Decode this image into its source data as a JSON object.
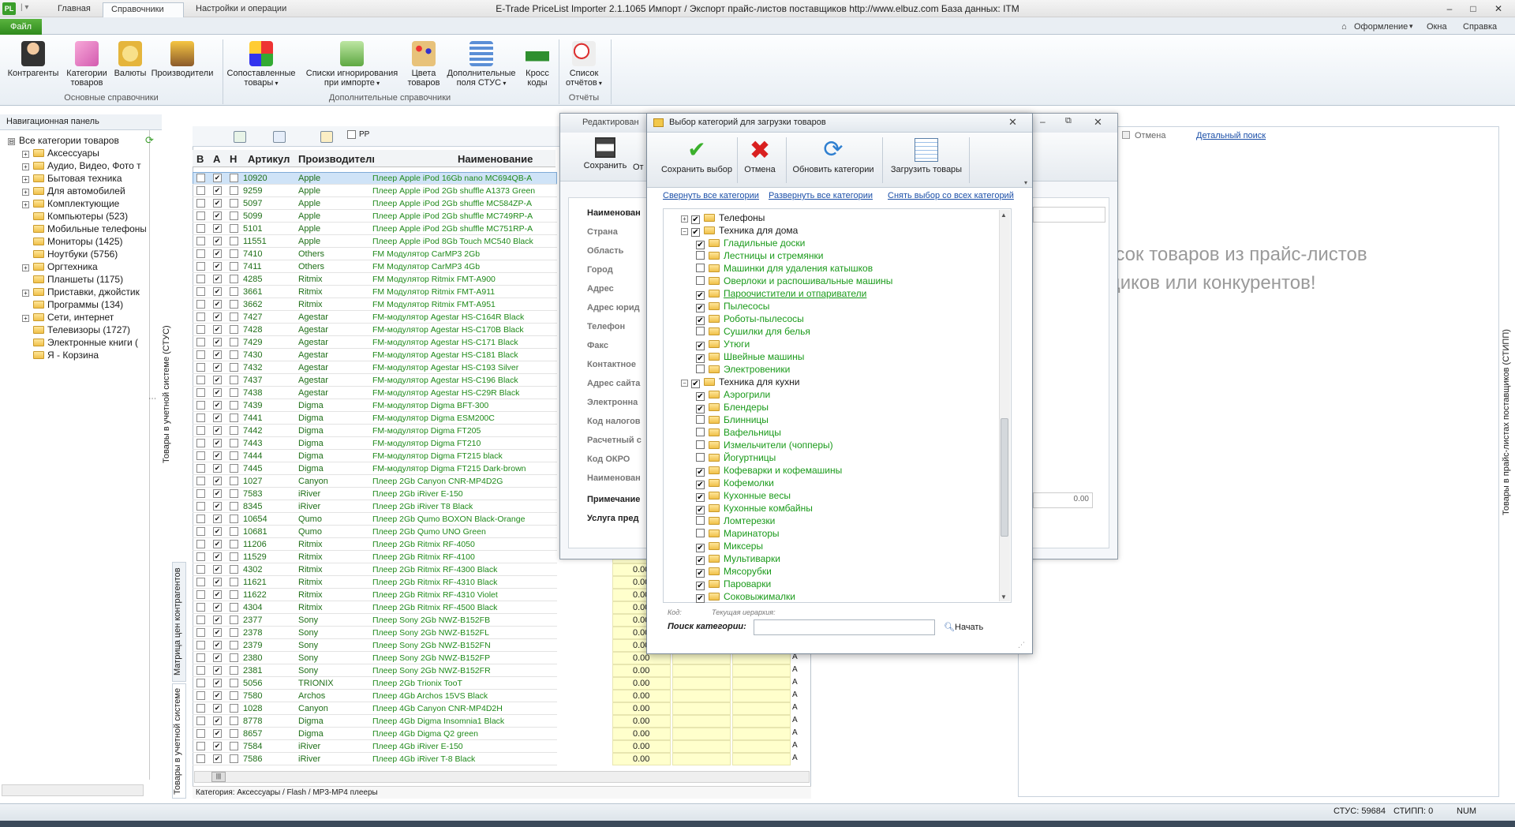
{
  "titlebar": {
    "app_badge": "PL",
    "qa_menu": "|  ▾",
    "title": "E-Trade PriceList Importer 2.1.1065      Импорт / Экспорт прайс-листов поставщиков      http://www.elbuz.com      База данных: ITM",
    "min": "–",
    "max": "□",
    "close": "✕"
  },
  "ribbon_tabs": {
    "file": "Файл",
    "home": "Главная",
    "refs": "Справочники",
    "settings": "Настройки и операции"
  },
  "right_menu": {
    "design": "Оформление",
    "windows": "Окна",
    "help": "Справка"
  },
  "ribbon": {
    "contractors": "Контрагенты",
    "categories_l1": "Категории",
    "categories_l2": "товаров",
    "currencies": "Валюты",
    "manufacturers": "Производители",
    "group1": "Основные справочники",
    "matched_l1": "Сопоставленные",
    "matched_l2": "товары",
    "ignore_l1": "Списки игнорирования",
    "ignore_l2": "при импорте",
    "colors_l1": "Цвета",
    "colors_l2": "товаров",
    "extra_l1": "Дополнительные",
    "extra_l2": "поля СТУС",
    "cross_l1": "Кросс",
    "cross_l2": "коды",
    "group2": "Дополнительные справочники",
    "reports_l1": "Список",
    "reports_l2": "отчётов",
    "group3": "Отчёты"
  },
  "nav": {
    "header": "Навигационная панель",
    "items": [
      {
        "label": "Все категории товаров",
        "level": 0,
        "exp": "⊟",
        "folder": false
      },
      {
        "label": "Аксессуары",
        "level": 1,
        "exp": "+",
        "folder": true
      },
      {
        "label": "Аудио, Видео, Фото т",
        "level": 1,
        "exp": "+",
        "folder": true
      },
      {
        "label": "Бытовая техника",
        "level": 1,
        "exp": "+",
        "folder": true
      },
      {
        "label": "Для автомобилей",
        "level": 1,
        "exp": "+",
        "folder": true
      },
      {
        "label": "Комплектующие",
        "level": 1,
        "exp": "+",
        "folder": true
      },
      {
        "label": "Компьютеры (523)",
        "level": 1,
        "exp": "",
        "folder": true
      },
      {
        "label": "Мобильные телефоны",
        "level": 1,
        "exp": "",
        "folder": true
      },
      {
        "label": "Мониторы (1425)",
        "level": 1,
        "exp": "",
        "folder": true
      },
      {
        "label": "Ноутбуки (5756)",
        "level": 1,
        "exp": "",
        "folder": true
      },
      {
        "label": "Оргтехника",
        "level": 1,
        "exp": "+",
        "folder": true
      },
      {
        "label": "Планшеты (1175)",
        "level": 1,
        "exp": "",
        "folder": true
      },
      {
        "label": "Приставки, джойстик",
        "level": 1,
        "exp": "+",
        "folder": true
      },
      {
        "label": "Программы (134)",
        "level": 1,
        "exp": "",
        "folder": true
      },
      {
        "label": "Сети, интернет",
        "level": 1,
        "exp": "+",
        "folder": true
      },
      {
        "label": "Телевизоры (1727)",
        "level": 1,
        "exp": "",
        "folder": true
      },
      {
        "label": "Электронные книги (",
        "level": 1,
        "exp": "",
        "folder": true
      },
      {
        "label": "Я - Корзина",
        "level": 1,
        "exp": "",
        "folder": true
      }
    ]
  },
  "side_tabs": {
    "left_stus": "Товары в учетной системе (СТУС)",
    "matrix": "Матрица цен контрагентов",
    "in_system": "Товары в учетной системе",
    "right_stipp": "Товары в прайс-листах поставщиков (СТИПП)"
  },
  "grid": {
    "toolbar_pp": "PP",
    "col_v": "В",
    "col_a": "А",
    "col_n": "Н",
    "col_art": "Артикул",
    "col_mfr": "Производитель",
    "col_name": "Наименование",
    "rows": [
      {
        "art": "10920",
        "mfr": "Apple",
        "name": "Плеер Apple iPod 16Gb nano MC694QB-A"
      },
      {
        "art": "9259",
        "mfr": "Apple",
        "name": "Плеер Apple iPod 2Gb shuffle A1373 Green"
      },
      {
        "art": "5097",
        "mfr": "Apple",
        "name": "Плеер Apple iPod 2Gb shuffle MC584ZP-A"
      },
      {
        "art": "5099",
        "mfr": "Apple",
        "name": "Плеер Apple iPod 2Gb shuffle MC749RP-A"
      },
      {
        "art": "5101",
        "mfr": "Apple",
        "name": "Плеер Apple iPod 2Gb shuffle MC751RP-A"
      },
      {
        "art": "11551",
        "mfr": "Apple",
        "name": "Плеер Apple iPod 8Gb Touch MC540 Black"
      },
      {
        "art": "7410",
        "mfr": "Others",
        "name": "FM Модулятор CarMP3 2Gb"
      },
      {
        "art": "7411",
        "mfr": "Others",
        "name": "FM Модулятор CarMP3 4Gb"
      },
      {
        "art": "4285",
        "mfr": "Ritmix",
        "name": "FM Модулятор Ritmix FMT-A900"
      },
      {
        "art": "3661",
        "mfr": "Ritmix",
        "name": "FM Модулятор Ritmix FMT-A911"
      },
      {
        "art": "3662",
        "mfr": "Ritmix",
        "name": "FM Модулятор Ritmix FMT-A951"
      },
      {
        "art": "7427",
        "mfr": "Agestar",
        "name": "FM-модулятор Agestar HS-C164R Black"
      },
      {
        "art": "7428",
        "mfr": "Agestar",
        "name": "FM-модулятор Agestar HS-C170B Black"
      },
      {
        "art": "7429",
        "mfr": "Agestar",
        "name": "FM-модулятор Agestar HS-C171 Black"
      },
      {
        "art": "7430",
        "mfr": "Agestar",
        "name": "FM-модулятор Agestar HS-C181 Black"
      },
      {
        "art": "7432",
        "mfr": "Agestar",
        "name": "FM-модулятор Agestar HS-C193 Silver"
      },
      {
        "art": "7437",
        "mfr": "Agestar",
        "name": "FM-модулятор Agestar HS-C196 Black"
      },
      {
        "art": "7438",
        "mfr": "Agestar",
        "name": "FM-модулятор Agestar HS-C29R Black"
      },
      {
        "art": "7439",
        "mfr": "Digma",
        "name": "FM-модулятор Digma BFT-300"
      },
      {
        "art": "7441",
        "mfr": "Digma",
        "name": "FM-модулятор Digma ESM200C"
      },
      {
        "art": "7442",
        "mfr": "Digma",
        "name": "FM-модулятор Digma FT205"
      },
      {
        "art": "7443",
        "mfr": "Digma",
        "name": "FM-модулятор Digma FT210"
      },
      {
        "art": "7444",
        "mfr": "Digma",
        "name": "FM-модулятор Digma FT215 black"
      },
      {
        "art": "7445",
        "mfr": "Digma",
        "name": "FM-модулятор Digma FT215 Dark-brown"
      },
      {
        "art": "1027",
        "mfr": "Canyon",
        "name": "Плеер 2Gb Canyon CNR-MP4D2G"
      },
      {
        "art": "7583",
        "mfr": "iRiver",
        "name": "Плеер 2Gb iRiver E-150"
      },
      {
        "art": "8345",
        "mfr": "iRiver",
        "name": "Плеер 2Gb iRiver T8 Black"
      },
      {
        "art": "10654",
        "mfr": "Qumo",
        "name": "Плеер 2Gb Qumo BOXON Black-Orange"
      },
      {
        "art": "10681",
        "mfr": "Qumo",
        "name": "Плеер 2Gb Qumo UNO Green"
      },
      {
        "art": "11206",
        "mfr": "Ritmix",
        "name": "Плеер 2Gb Ritmix RF-4050"
      },
      {
        "art": "11529",
        "mfr": "Ritmix",
        "name": "Плеер 2Gb Ritmix RF-4100"
      },
      {
        "art": "4302",
        "mfr": "Ritmix",
        "name": "Плеер 2Gb Ritmix RF-4300 Black"
      },
      {
        "art": "11621",
        "mfr": "Ritmix",
        "name": "Плеер 2Gb Ritmix RF-4310 Black"
      },
      {
        "art": "11622",
        "mfr": "Ritmix",
        "name": "Плеер 2Gb Ritmix RF-4310 Violet"
      },
      {
        "art": "4304",
        "mfr": "Ritmix",
        "name": "Плеер 2Gb Ritmix RF-4500 Black"
      },
      {
        "art": "2377",
        "mfr": "Sony",
        "name": "Плеер Sony 2Gb NWZ-B152FB"
      },
      {
        "art": "2378",
        "mfr": "Sony",
        "name": "Плеер Sony 2Gb NWZ-B152FL"
      },
      {
        "art": "2379",
        "mfr": "Sony",
        "name": "Плеер Sony 2Gb NWZ-B152FN"
      },
      {
        "art": "2380",
        "mfr": "Sony",
        "name": "Плеер Sony 2Gb NWZ-B152FP"
      },
      {
        "art": "2381",
        "mfr": "Sony",
        "name": "Плеер Sony 2Gb NWZ-B152FR"
      },
      {
        "art": "5056",
        "mfr": "TRIONIX",
        "name": "Плеер 2Gb Trionix TooT"
      },
      {
        "art": "7580",
        "mfr": "Archos",
        "name": "Плеер 4Gb Archos 15VS Black"
      },
      {
        "art": "1028",
        "mfr": "Canyon",
        "name": "Плеер 4Gb Canyon CNR-MP4D2H"
      },
      {
        "art": "8778",
        "mfr": "Digma",
        "name": "Плеер 4Gb Digma Insomnia1 Black"
      },
      {
        "art": "8657",
        "mfr": "Digma",
        "name": "Плеер 4Gb Digma Q2 green"
      },
      {
        "art": "7584",
        "mfr": "iRiver",
        "name": "Плеер 4Gb iRiver E-150"
      },
      {
        "art": "7586",
        "mfr": "iRiver",
        "name": "Плеер 4Gb iRiver T-8 Black"
      }
    ],
    "price_zero": "0.00",
    "price_col_suffix": "А",
    "status": "Категория: Аксессуары / Flash / MP3-MP4 плееры"
  },
  "edit_dialog": {
    "title": "Редактирован",
    "save": "Сохранить",
    "cancel_short": "От",
    "fields": [
      "Наименован",
      "Страна",
      "Область",
      "Город",
      "Адрес",
      "Адрес юрид",
      "Телефон",
      "Факс",
      "Контактное",
      "Адрес сайта",
      "Электронна",
      "Код налогов",
      "Расчетный с",
      "Код ОКРО",
      "Наименован",
      "Примечание",
      "Услуга пред"
    ],
    "zero": "0.00"
  },
  "background": {
    "cancel": "Отмена",
    "detail_search": "Детальный поиск",
    "hint_l1": "исок товаров из прайс-листов",
    "hint_l2": "щиков или конкурентов!"
  },
  "cat_dialog": {
    "title": "Выбор категорий для загрузки товаров",
    "save": "Сохранить выбор",
    "cancel": "Отмена",
    "refresh": "Обновить категории",
    "load": "Загрузить товары",
    "collapse_all": "Свернуть все категории",
    "expand_all": "Развернуть все категории",
    "deselect_all": "Снять выбор со всех категорий",
    "tree": [
      {
        "label": "Телефоны",
        "parent": true,
        "checked": true,
        "exp": "+"
      },
      {
        "label": "Техника для дома",
        "parent": true,
        "checked": true,
        "exp": "−"
      },
      {
        "label": "Гладильные доски",
        "checked": true
      },
      {
        "label": "Лестницы и стремянки",
        "checked": false
      },
      {
        "label": "Машинки для удаления катышков",
        "checked": false
      },
      {
        "label": "Оверлоки и распошивальные машины",
        "checked": false
      },
      {
        "label": "Пароочистители и отпариватели",
        "checked": true,
        "under": true
      },
      {
        "label": "Пылесосы",
        "checked": true
      },
      {
        "label": "Роботы-пылесосы",
        "checked": true
      },
      {
        "label": "Сушилки для белья",
        "checked": false
      },
      {
        "label": "Утюги",
        "checked": true
      },
      {
        "label": "Швейные машины",
        "checked": true
      },
      {
        "label": "Электровеники",
        "checked": false
      },
      {
        "label": "Техника для кухни",
        "parent": true,
        "checked": true,
        "exp": "−"
      },
      {
        "label": "Аэрогрили",
        "checked": true
      },
      {
        "label": "Блендеры",
        "checked": true
      },
      {
        "label": "Блинницы",
        "checked": false
      },
      {
        "label": "Вафельницы",
        "checked": false
      },
      {
        "label": "Измельчители (чопперы)",
        "checked": false
      },
      {
        "label": "Йогуртницы",
        "checked": false
      },
      {
        "label": "Кофеварки и кофемашины",
        "checked": true
      },
      {
        "label": "Кофемолки",
        "checked": true
      },
      {
        "label": "Кухонные весы",
        "checked": true
      },
      {
        "label": "Кухонные комбайны",
        "checked": true
      },
      {
        "label": "Ломтерезки",
        "checked": false
      },
      {
        "label": "Маринаторы",
        "checked": false
      },
      {
        "label": "Миксеры",
        "checked": true
      },
      {
        "label": "Мультиварки",
        "checked": true
      },
      {
        "label": "Мясорубки",
        "checked": true
      },
      {
        "label": "Пароварки",
        "checked": true
      },
      {
        "label": "Соковыжималки",
        "checked": true
      }
    ],
    "code_label": "Код:",
    "hierarchy_label": "Текущая иерархия:",
    "search_label": "Поиск категории:",
    "search_value": "",
    "start": "Начать"
  },
  "statusbar": {
    "stus": "СТУС: 59684",
    "stipp": "СТИПП: 0",
    "num": "NUM"
  }
}
